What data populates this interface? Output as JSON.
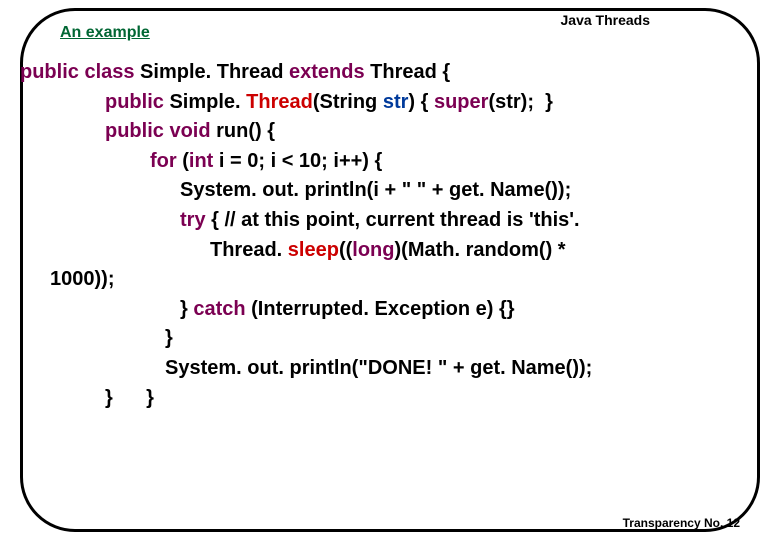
{
  "header": "Java Threads",
  "title": "An example",
  "code": {
    "l1_a": "public class",
    "l1_b": " Simple. Thread ",
    "l1_c": "extends",
    "l1_d": " Thread {",
    "l2_a": "public",
    "l2_b": " Simple. ",
    "l2_c": "Thread",
    "l2_d": "(String ",
    "l2_e": "str",
    "l2_f": ") { ",
    "l2_g": "super",
    "l2_h": "(str);  }",
    "l3_a": "public void",
    "l3_b": " run() {",
    "l4_a": "for",
    "l4_b": " (",
    "l4_c": "int",
    "l4_d": " i = 0; i < 10; i++) {",
    "l5": "System. out. println(i + \" \" + get. Name());",
    "l6_a": "try",
    "l6_b": " { // at this point, current thread is 'this'.",
    "l7_a": "Thread. ",
    "l7_b": "sleep",
    "l7_c": "((",
    "l7_d": "long",
    "l7_e": ")(Math. random() * ",
    "l8": "1000));",
    "l9_a": "} ",
    "l9_b": "catch",
    "l9_c": " (Interrupted. Exception e) {}",
    "l10": "}",
    "l11": "System. out. println(\"DONE! \" + get. Name());",
    "l12": "}      }"
  },
  "footer": "Transparency No. 12"
}
